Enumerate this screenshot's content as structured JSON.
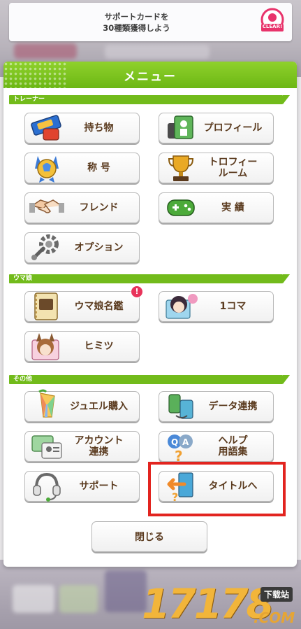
{
  "banner": {
    "text": "サポートカードを\n30種類獲得しよう",
    "badge_label": "CLEAR!"
  },
  "menu": {
    "title": "メニュー",
    "sections": {
      "trainer": "トレーナー",
      "uma": "ウマ娘",
      "other": "その他"
    },
    "items": {
      "inventory": "持ち物",
      "profile": "プロフィール",
      "title_name": "称 号",
      "trophy_room": "トロフィー\nルーム",
      "friend": "フレンド",
      "achievements": "実 績",
      "options": "オプション",
      "uma_encyclopedia": "ウマ娘名鑑",
      "one_koma": "1コマ",
      "secret": "ヒミツ",
      "jewel_purchase": "ジュエル購入",
      "data_link": "データ連携",
      "account_link": "アカウント\n連携",
      "help": "ヘルプ\n用語集",
      "support": "サポート",
      "to_title": "タイトルへ"
    },
    "notification_mark": "!",
    "close_label": "閉じる"
  },
  "watermark": {
    "number": "17178",
    "tag": "下载站",
    "suffix": ".COM"
  },
  "colors": {
    "accent_green": "#72bb1b",
    "label_brown": "#5a3a1e",
    "highlight_red": "#e2241f",
    "badge_pink": "#e8335a"
  }
}
